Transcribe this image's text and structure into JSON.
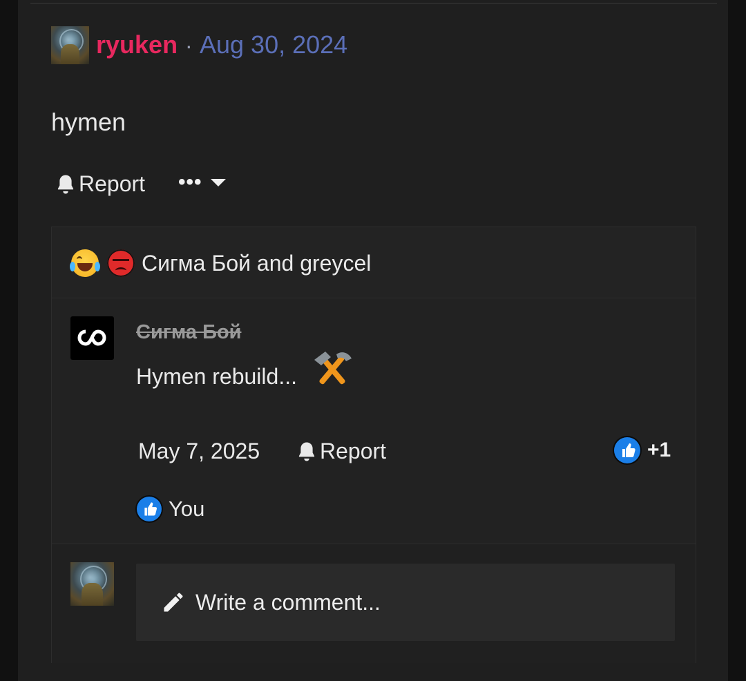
{
  "post": {
    "author": "ryuken",
    "separator": "·",
    "date": "Aug 30, 2024",
    "body": "hymen",
    "report_label": "Report",
    "more_label": "•••"
  },
  "reactions": {
    "summary_text": "Сигма Бой and greycel",
    "emojis": [
      "laughing-crying-emoji",
      "angry-face-emoji"
    ]
  },
  "comment": {
    "author": "Сигма Бой",
    "text": "Hymen rebuild...",
    "emoji": "hammer-and-pick-emoji",
    "date": "May 7, 2025",
    "report_label": "Report",
    "like_count": "+1",
    "liked_by": "You"
  },
  "composer": {
    "placeholder": "Write a comment..."
  },
  "colors": {
    "author_accent": "#e8285f",
    "date_accent": "#5b6fb8",
    "like_blue": "#1b7fe8",
    "background": "#1f1f1f"
  }
}
